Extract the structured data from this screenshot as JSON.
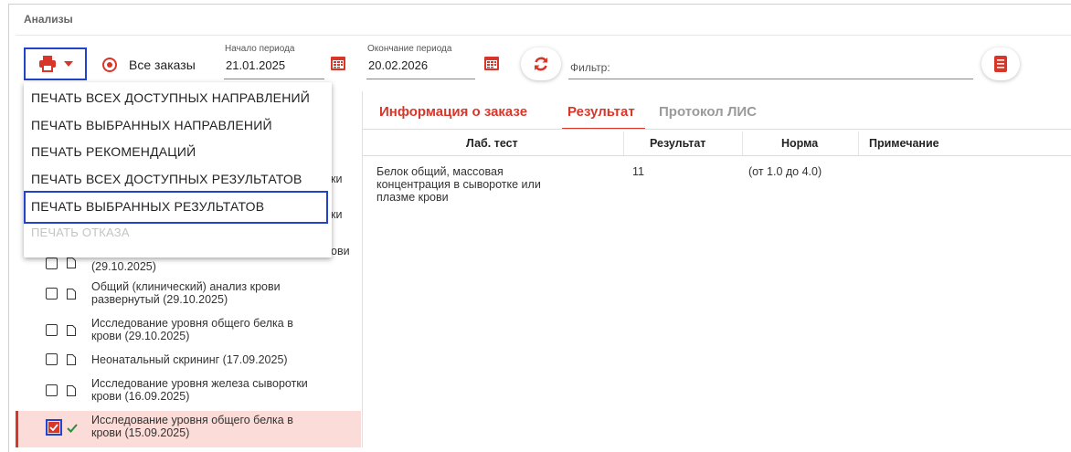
{
  "section_title": "Анализы",
  "toolbar": {
    "radio_label": "Все заказы",
    "start": {
      "caption": "Начало периода",
      "value": "21.01.2025"
    },
    "end": {
      "caption": "Окончание периода",
      "value": "20.02.2026"
    },
    "filter_label": "Фильтр:"
  },
  "print_menu": {
    "items": [
      "ПЕЧАТЬ ВСЕХ ДОСТУПНЫХ НАПРАВЛЕНИЙ",
      "ПЕЧАТЬ ВЫБРАННЫХ НАПРАВЛЕНИЙ",
      "ПЕЧАТЬ РЕКОМЕНДАЦИЙ",
      "ПЕЧАТЬ ВСЕХ ДОСТУПНЫХ РЕЗУЛЬТАТОВ",
      "ПЕЧАТЬ ВЫБРАННЫХ РЕЗУЛЬТАТОВ",
      "ПЕЧАТЬ ОТКАЗА"
    ],
    "highlighted_index": 4,
    "disabled_index": 5
  },
  "orders": {
    "peek": [
      "ки",
      "ки",
      "ови"
    ],
    "items": [
      {
        "line1": "(29.10.2025)",
        "line2": ""
      },
      {
        "line1": "Общий (клинический) анализ крови",
        "line2": "развернутый (29.10.2025)"
      },
      {
        "line1": "Исследование уровня общего белка в",
        "line2": "крови (29.10.2025)"
      },
      {
        "line1": "Неонатальный скрининг (17.09.2025)",
        "line2": ""
      },
      {
        "line1": "Исследование уровня железа сыворотки",
        "line2": "крови (16.09.2025)"
      },
      {
        "line1": "Исследование уровня общего белка в",
        "line2": "крови (15.09.2025)"
      }
    ]
  },
  "tabs": [
    "Информация о заказе",
    "Результат",
    "Протокол ЛИС"
  ],
  "table": {
    "headers": [
      "Лаб. тест",
      "Результат",
      "Норма",
      "Примечание"
    ],
    "rows": [
      {
        "test_lines": [
          "Белок общий, массовая",
          "концентрация в сыворотке или",
          "плазме крови"
        ],
        "result": "11",
        "norm": "(от 1.0 до 4.0)",
        "note": ""
      }
    ]
  },
  "colors": {
    "accent": "#d9362a",
    "highlight": "#2244cc",
    "selected_row": "#fbdcd8"
  }
}
